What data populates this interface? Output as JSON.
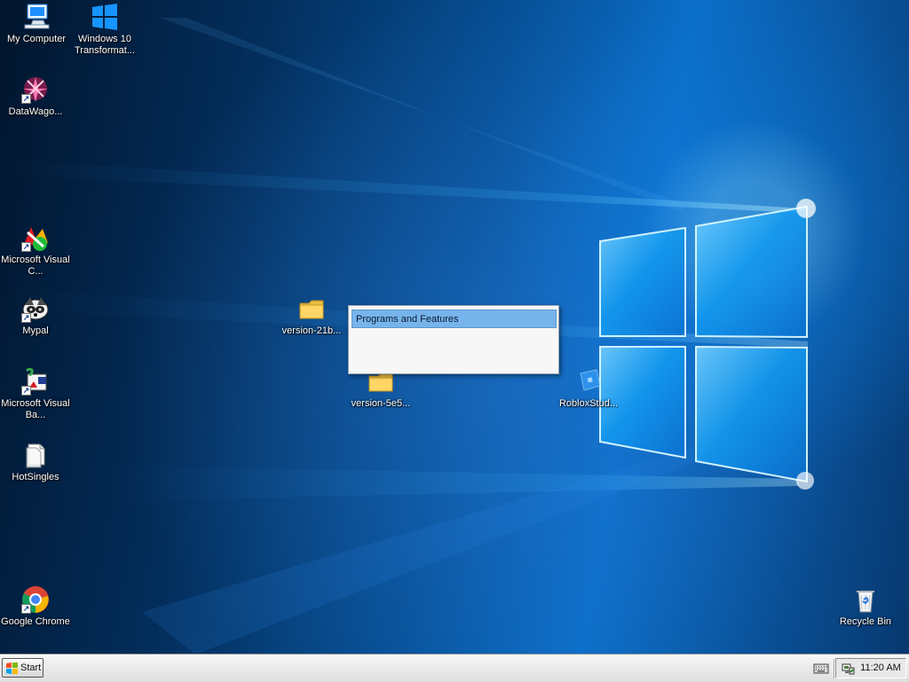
{
  "desktop": {
    "icons": [
      {
        "label": "My Computer",
        "icon": "computer-icon"
      },
      {
        "label": "Windows 10 Transformat...",
        "icon": "windows-logo-icon"
      },
      {
        "label": "DataWago...",
        "icon": "flower-icon"
      },
      {
        "label": "Microsoft Visual C...",
        "icon": "visual-c-icon"
      },
      {
        "label": "Mypal",
        "icon": "raccoon-icon"
      },
      {
        "label": "Microsoft Visual Ba...",
        "icon": "visual-basic-icon"
      },
      {
        "label": "HotSingles",
        "icon": "document-icon"
      },
      {
        "label": "version-21b...",
        "icon": "folder-icon"
      },
      {
        "label": "version-5e5...",
        "icon": "folder-icon"
      },
      {
        "label": "RobloxStud...",
        "icon": "roblox-studio-icon"
      },
      {
        "label": "Google Chrome",
        "icon": "chrome-icon"
      },
      {
        "label": "Recycle Bin",
        "icon": "recycle-bin-icon"
      }
    ],
    "context_menu": {
      "items": [
        {
          "label": "Programs and Features",
          "selected": true
        }
      ]
    }
  },
  "taskbar": {
    "start_label": "Start",
    "tray": {
      "keyboard_icon": "keyboard-icon",
      "network_icon": "network-icon",
      "time": "11:20 AM"
    }
  },
  "colors": {
    "taskbar": "#e8e8e8",
    "menu_highlight": "#76b4eb",
    "desktop_blue": "#0b6ec8"
  }
}
